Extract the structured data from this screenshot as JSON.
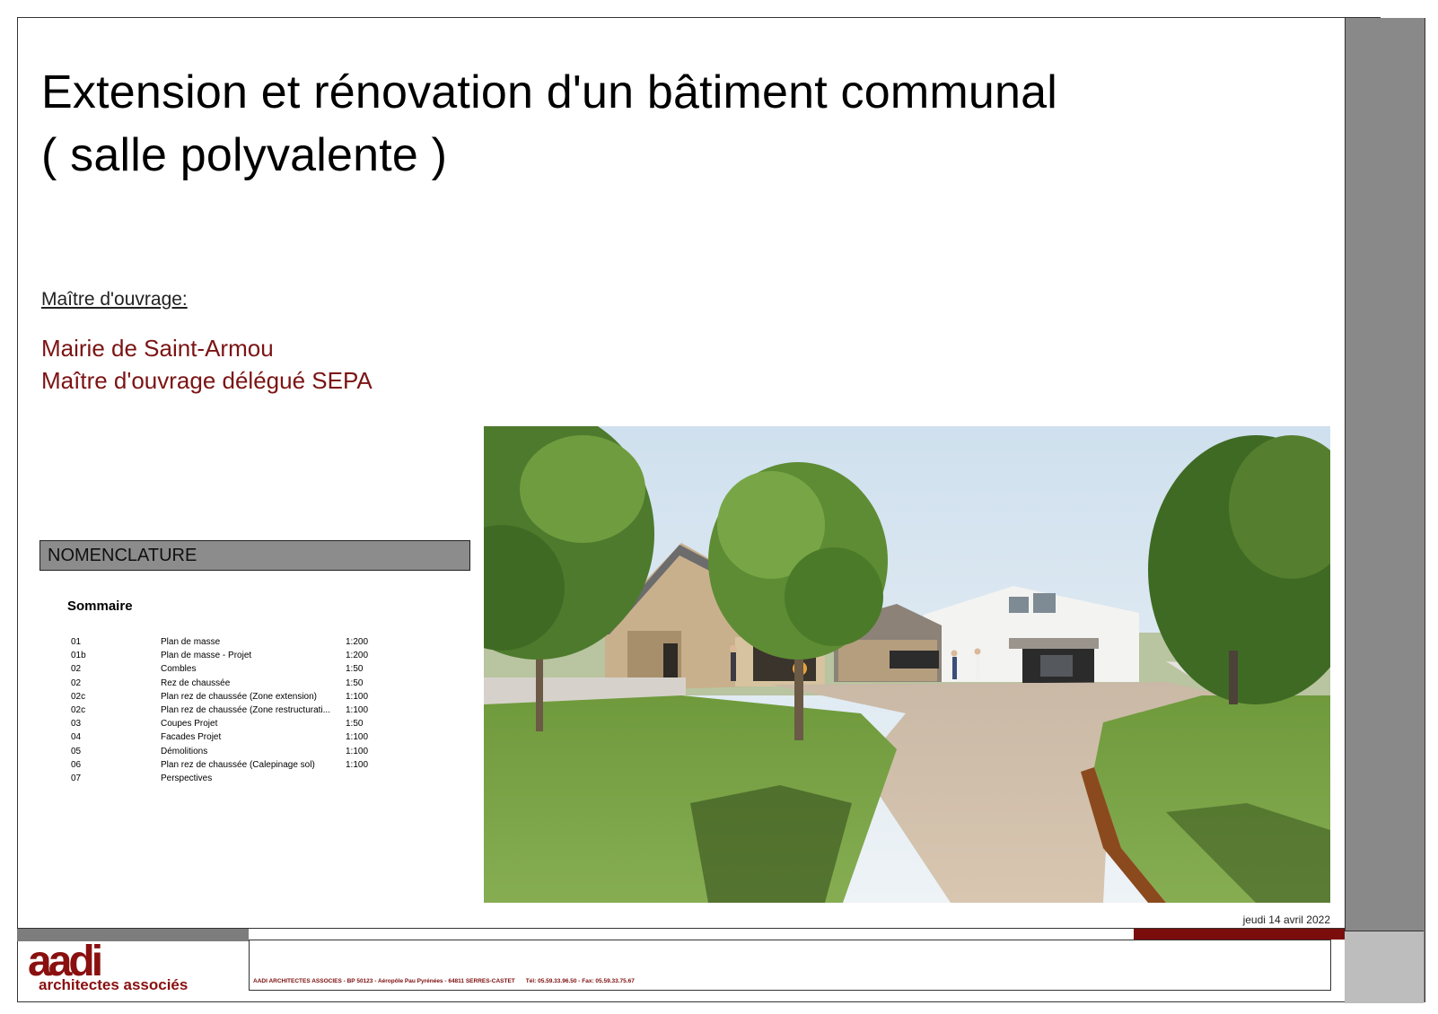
{
  "title": {
    "line1": "Extension et rénovation d'un bâtiment communal",
    "line2": "( salle polyvalente )"
  },
  "maitre_ouvrage": {
    "label": "Maître d'ouvrage:",
    "line1": "Mairie de Saint-Armou",
    "line2": "Maître d'ouvrage délégué SEPA"
  },
  "nomenclature": {
    "heading": "NOMENCLATURE",
    "sommaire": "Sommaire",
    "rows": [
      {
        "num": "01",
        "title": "Plan de masse",
        "scale": "1:200"
      },
      {
        "num": "01b",
        "title": "Plan de masse - Projet",
        "scale": "1:200"
      },
      {
        "num": "02",
        "title": "Combles",
        "scale": "1:50"
      },
      {
        "num": "02",
        "title": "Rez de chaussée",
        "scale": "1:50"
      },
      {
        "num": "02c",
        "title": "Plan rez de chaussée (Zone extension)",
        "scale": "1:100"
      },
      {
        "num": "02c",
        "title": "Plan rez de chaussée (Zone restructurati...",
        "scale": "1:100"
      },
      {
        "num": "03",
        "title": "Coupes Projet",
        "scale": "1:50"
      },
      {
        "num": "04",
        "title": "Facades Projet",
        "scale": "1:100"
      },
      {
        "num": "05",
        "title": "Démolitions",
        "scale": "1:100"
      },
      {
        "num": "06",
        "title": "Plan rez de chaussée (Calepinage sol)",
        "scale": "1:100"
      },
      {
        "num": "07",
        "title": "Perspectives",
        "scale": ""
      }
    ]
  },
  "date": "jeudi 14 avril 2022",
  "footer": {
    "logo_mark": "aadi",
    "logo_name": "architectes associés",
    "address": "AADI ARCHITECTES ASSOCIES - BP 50123 - Aéropôle Pau Pyrénées - 64811 SERRES-CASTET",
    "phone": "Tél: 05.59.33.96.50 - Fax: 05.59.33.75.67"
  },
  "colors": {
    "accent_red": "#7b1313",
    "grey_bar": "#898989"
  }
}
